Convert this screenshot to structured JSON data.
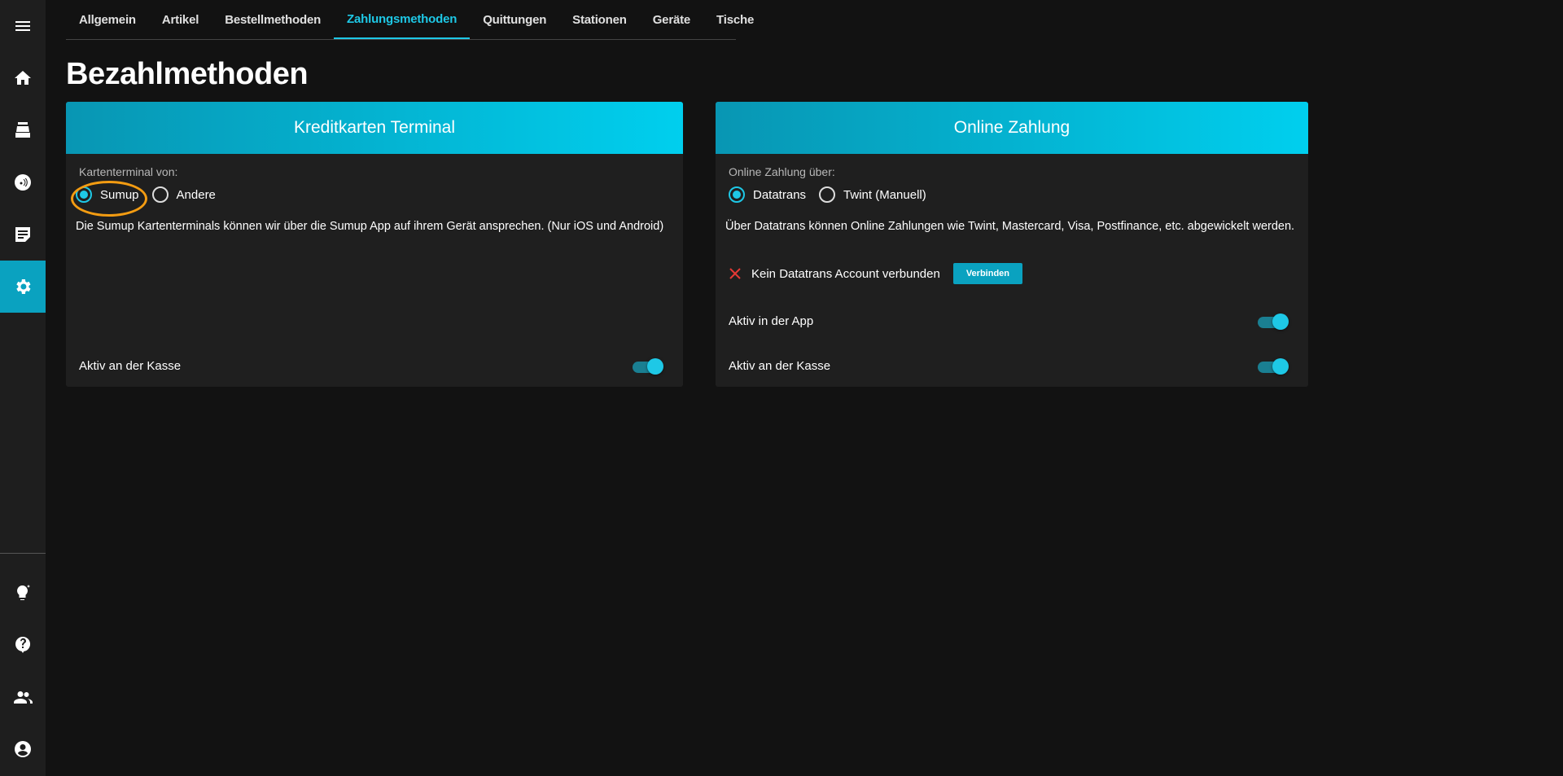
{
  "sidebar": {
    "items": [
      {
        "icon": "menu-icon"
      },
      {
        "icon": "home-icon"
      },
      {
        "icon": "cash-register-icon"
      },
      {
        "icon": "nfc-icon"
      },
      {
        "icon": "note-icon"
      },
      {
        "icon": "gear-icon",
        "active": true
      },
      {
        "icon": "lightbulb-icon"
      },
      {
        "icon": "help-icon"
      },
      {
        "icon": "users-icon"
      },
      {
        "icon": "account-icon"
      }
    ]
  },
  "tabs": [
    {
      "label": "Allgemein"
    },
    {
      "label": "Artikel"
    },
    {
      "label": "Bestellmethoden"
    },
    {
      "label": "Zahlungsmethoden",
      "active": true
    },
    {
      "label": "Quittungen"
    },
    {
      "label": "Stationen"
    },
    {
      "label": "Geräte"
    },
    {
      "label": "Tische"
    }
  ],
  "page": {
    "title": "Bezahlmethoden"
  },
  "card_terminal": {
    "title": "Kreditkarten Terminal",
    "provider_label": "Kartenterminal von:",
    "options": [
      {
        "label": "Sumup",
        "selected": true
      },
      {
        "label": "Andere",
        "selected": false
      }
    ],
    "description": "Die Sumup Kartenterminals können wir über die Sumup App auf ihrem Gerät ansprechen. (Nur iOS und Android)",
    "active_pos_label": "Aktiv an der Kasse",
    "active_pos": true
  },
  "card_online": {
    "title": "Online Zahlung",
    "provider_label": "Online Zahlung über:",
    "options": [
      {
        "label": "Datatrans",
        "selected": true
      },
      {
        "label": "Twint (Manuell)",
        "selected": false
      }
    ],
    "description": "Über Datatrans können Online Zahlungen wie Twint, Mastercard, Visa, Postfinance, etc. abgewickelt werden.",
    "status_text": "Kein Datatrans Account verbunden",
    "connect_label": "Verbinden",
    "active_app_label": "Aktiv in der App",
    "active_app": true,
    "active_pos_label": "Aktiv an der Kasse",
    "active_pos": true
  },
  "colors": {
    "accent": "#1ec8e6",
    "active_sidebar": "#0aa2c0",
    "highlight": "#f39c12",
    "error": "#e53935"
  }
}
